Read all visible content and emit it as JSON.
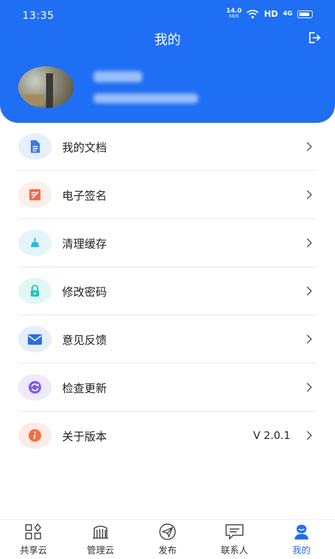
{
  "status_bar": {
    "time": "13:35",
    "speed_value": "14.0",
    "speed_unit": "KB/S",
    "hd": "HD",
    "signal": "4G"
  },
  "header": {
    "title": "我的"
  },
  "menu": {
    "items": [
      {
        "label": "我的文档",
        "icon": "document-icon",
        "color": "#3d7bf2",
        "bg": "#e6effd"
      },
      {
        "label": "电子签名",
        "icon": "signature-icon",
        "color": "#f26b47",
        "bg": "#fdeee8"
      },
      {
        "label": "清理缓存",
        "icon": "broom-icon",
        "color": "#2fb4e6",
        "bg": "#e3f5fb"
      },
      {
        "label": "修改密码",
        "icon": "lock-icon",
        "color": "#26c7b8",
        "bg": "#e1f7f4"
      },
      {
        "label": "意见反馈",
        "icon": "mail-icon",
        "color": "#2a6ee6",
        "bg": "#e6eefb"
      },
      {
        "label": "检查更新",
        "icon": "refresh-icon",
        "color": "#7d5ce6",
        "bg": "#eeeafc"
      },
      {
        "label": "关于版本",
        "icon": "info-icon",
        "color": "#f07143",
        "bg": "#fdece6",
        "value": "V 2.0.1"
      }
    ]
  },
  "tabbar": {
    "tabs": [
      {
        "label": "共享云",
        "icon": "share-cloud-icon"
      },
      {
        "label": "管理云",
        "icon": "manage-cloud-icon"
      },
      {
        "label": "发布",
        "icon": "paper-plane-icon"
      },
      {
        "label": "联系人",
        "icon": "message-icon"
      },
      {
        "label": "我的",
        "icon": "profile-icon",
        "active": true
      }
    ]
  },
  "colors": {
    "primary": "#1f6ff4"
  }
}
